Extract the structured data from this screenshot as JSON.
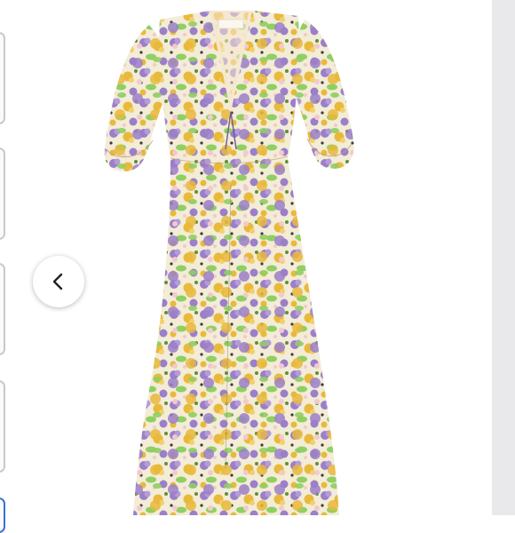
{
  "viewer": {
    "thumbnails": [
      {
        "name": "thumbnail-1",
        "selected": false
      },
      {
        "name": "thumbnail-2",
        "selected": false
      },
      {
        "name": "thumbnail-3",
        "selected": false
      },
      {
        "name": "thumbnail-4",
        "selected": false
      },
      {
        "name": "thumbnail-5",
        "selected": true
      }
    ],
    "prev_icon": "chevron-left-icon",
    "product": {
      "label_text": "FAITHFULL",
      "print_colors": {
        "base": "#f3ecd6",
        "purple": "#9b7fc8",
        "yellow": "#e9b93c",
        "green": "#8fcf63",
        "pink": "#f2c9cf"
      }
    }
  }
}
